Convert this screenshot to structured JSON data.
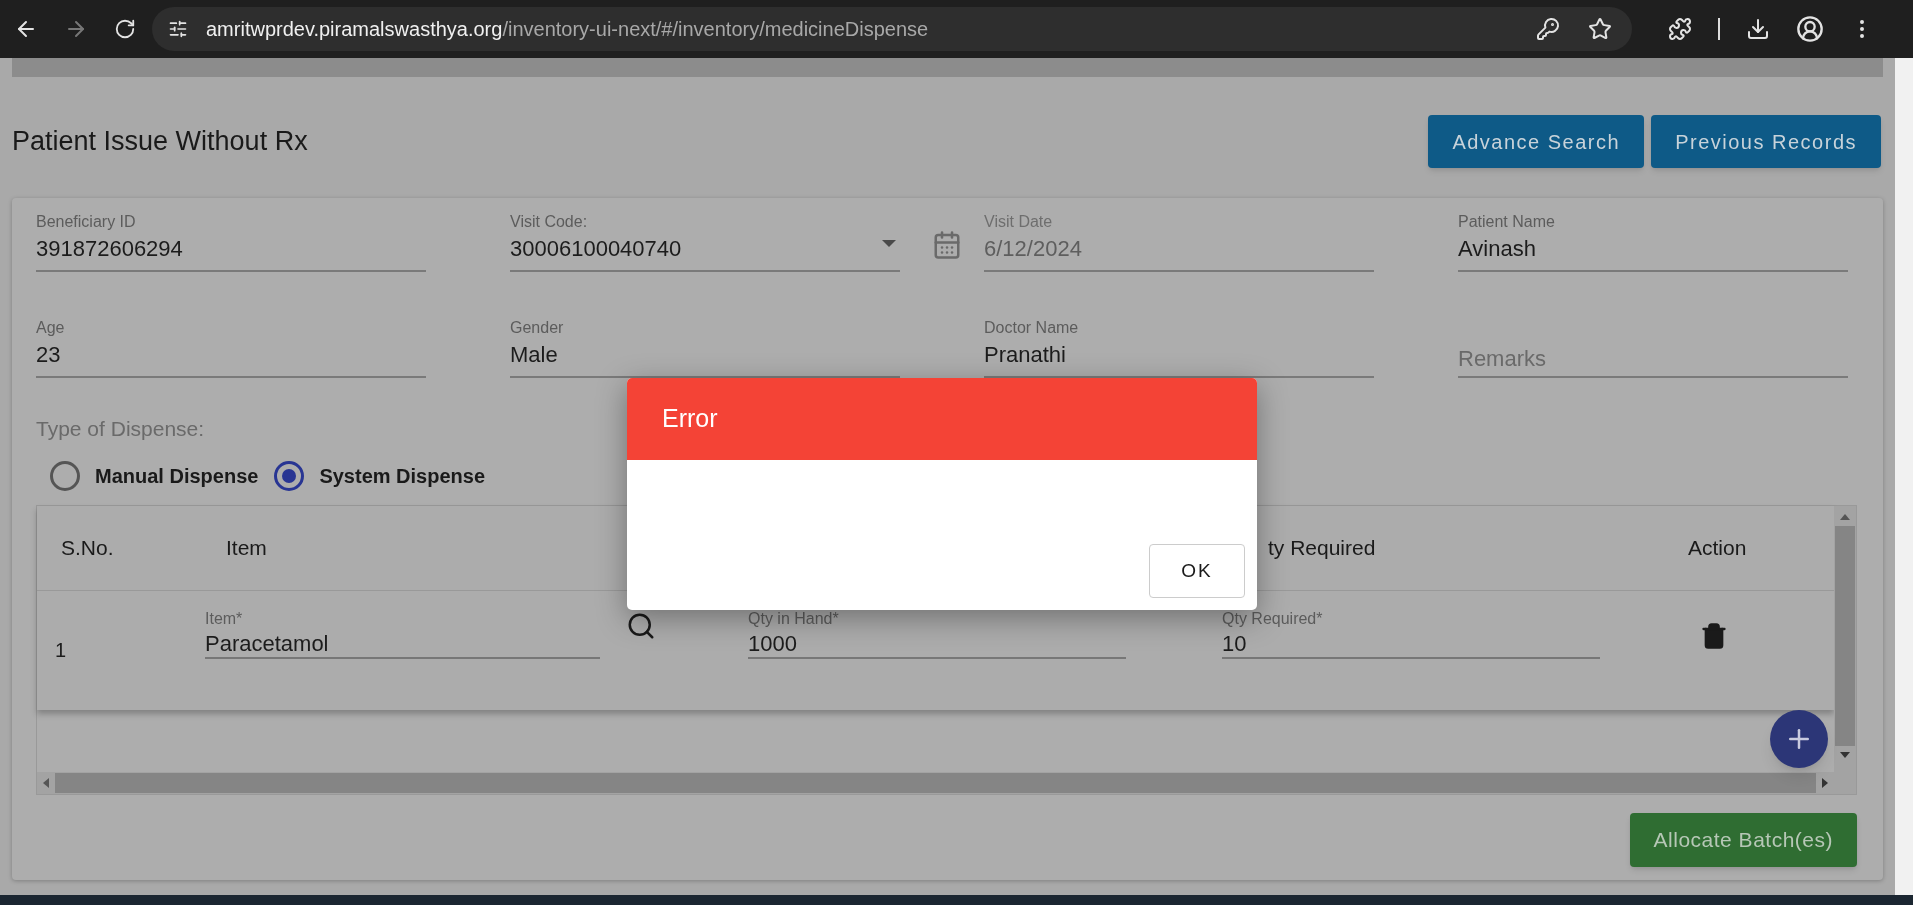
{
  "browser": {
    "host": "amritwprdev.piramalswasthya.org",
    "path": "/inventory-ui-next/#/inventory/medicineDispense"
  },
  "page": {
    "title": "Patient Issue Without Rx",
    "buttons": [
      "Advance Search",
      "Previous Records"
    ]
  },
  "form": {
    "fields": [
      {
        "kind": "text",
        "label": "Beneficiary ID",
        "value": "391872606294"
      },
      {
        "kind": "select",
        "label": "Visit Code:",
        "value": "30006100040740"
      },
      {
        "kind": "date",
        "label": "Visit Date",
        "value": "6/12/2024"
      },
      {
        "kind": "text",
        "label": "Patient Name",
        "value": "Avinash"
      },
      {
        "kind": "text",
        "label": "Age",
        "value": "23"
      },
      {
        "kind": "text",
        "label": "Gender",
        "value": "Male"
      },
      {
        "kind": "text",
        "label": "Doctor Name",
        "value": "Pranathi"
      },
      {
        "kind": "placeholder",
        "label": "Remarks"
      }
    ]
  },
  "dispense": {
    "label": "Type of Dispense:",
    "options": [
      {
        "label": "Manual Dispense",
        "selected": false
      },
      {
        "label": "System Dispense",
        "selected": true
      }
    ]
  },
  "table": {
    "columns": [
      "S.No.",
      "Item",
      "ty Required",
      "Action"
    ],
    "rows": [
      {
        "sno": "1",
        "item_label": "Item*",
        "item": "Paracetamol",
        "qty_hand_label": "Qty in Hand*",
        "qty_hand": "1000",
        "qty_req_label": "Qty Required*",
        "qty_req": "10"
      }
    ]
  },
  "allocate_button": "Allocate Batch(es)",
  "dialog": {
    "title": "Error",
    "button": "OK"
  }
}
